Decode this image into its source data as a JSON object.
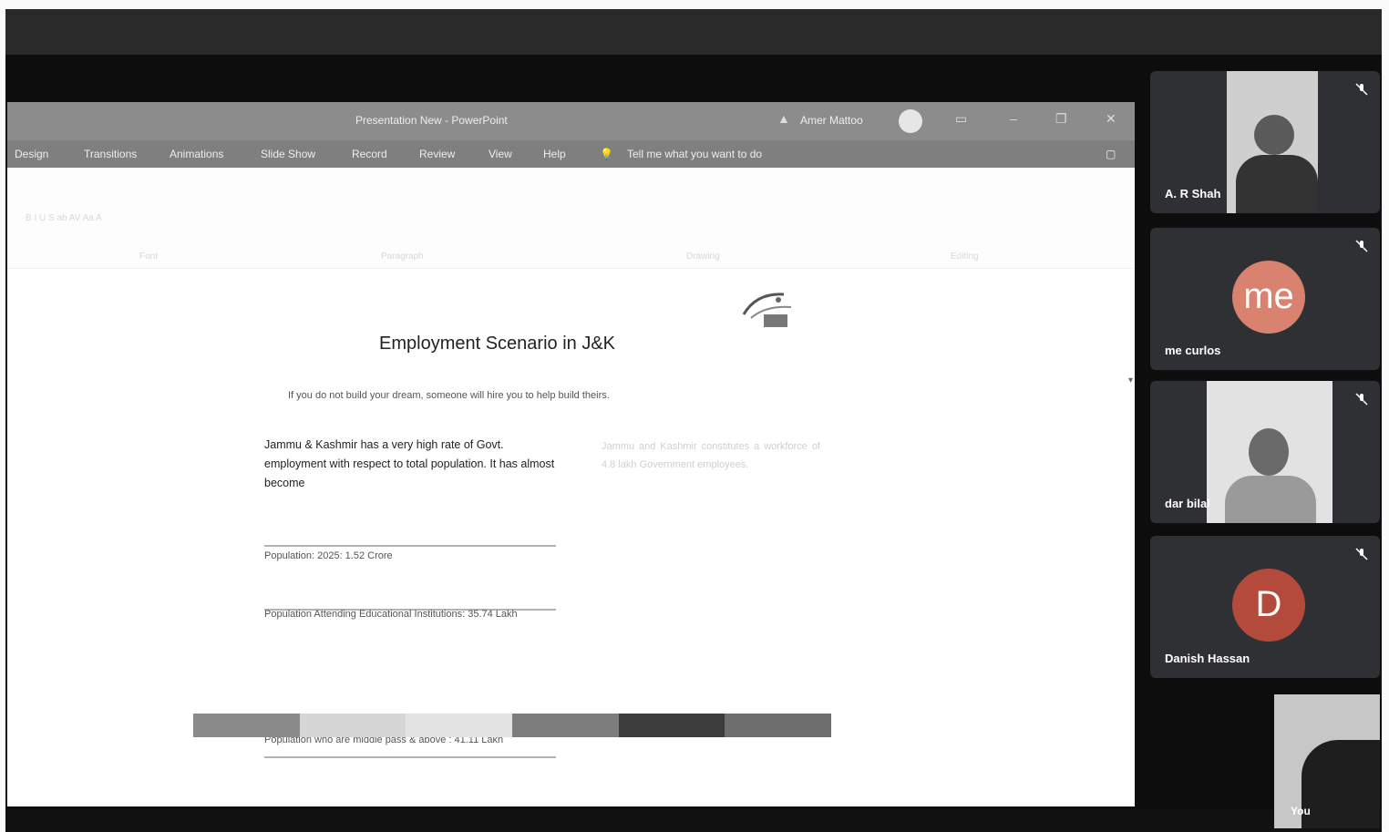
{
  "ppt": {
    "title": "Presentation New - PowerPoint",
    "user": "Amer Mattoo",
    "menu": [
      "Design",
      "Transitions",
      "Animations",
      "Slide Show",
      "Record",
      "Review",
      "View",
      "Help"
    ],
    "tell_me": "Tell me what you want to do"
  },
  "slide": {
    "title": "Employment Scenario in J&K",
    "quote": "If you do not build your dream, someone will hire you to help build theirs.",
    "left_paragraph": "Jammu & Kashmir has a very high rate of Govt. employment with respect to total population. It has almost become",
    "stat_1": "Population: 2025: 1.52 Crore",
    "stat_2": "Population Attending Educational Institutions: 35.74 Lakh",
    "stat_3": "Population who are middle pass & above : 41.11 Lakh",
    "right_paragraph_1": "Jammu and Kashmir constitutes a workforce of 4.8 lakh Government employees."
  },
  "participants": [
    {
      "name": "A. R Shah",
      "type": "video"
    },
    {
      "name": "me curlos",
      "type": "initial",
      "initial": "me",
      "color": "#d9826f"
    },
    {
      "name": "dar bilal",
      "type": "video"
    },
    {
      "name": "Danish Hassan",
      "type": "initial",
      "initial": "D",
      "color": "#b44a3c"
    }
  ],
  "self_view": {
    "name": "You"
  },
  "colors": {
    "bar": [
      "#8a8a8a",
      "#d6d6d6",
      "#e3e3e3",
      "#7d7d7d",
      "#3c3c3c",
      "#6e6e6e"
    ]
  }
}
